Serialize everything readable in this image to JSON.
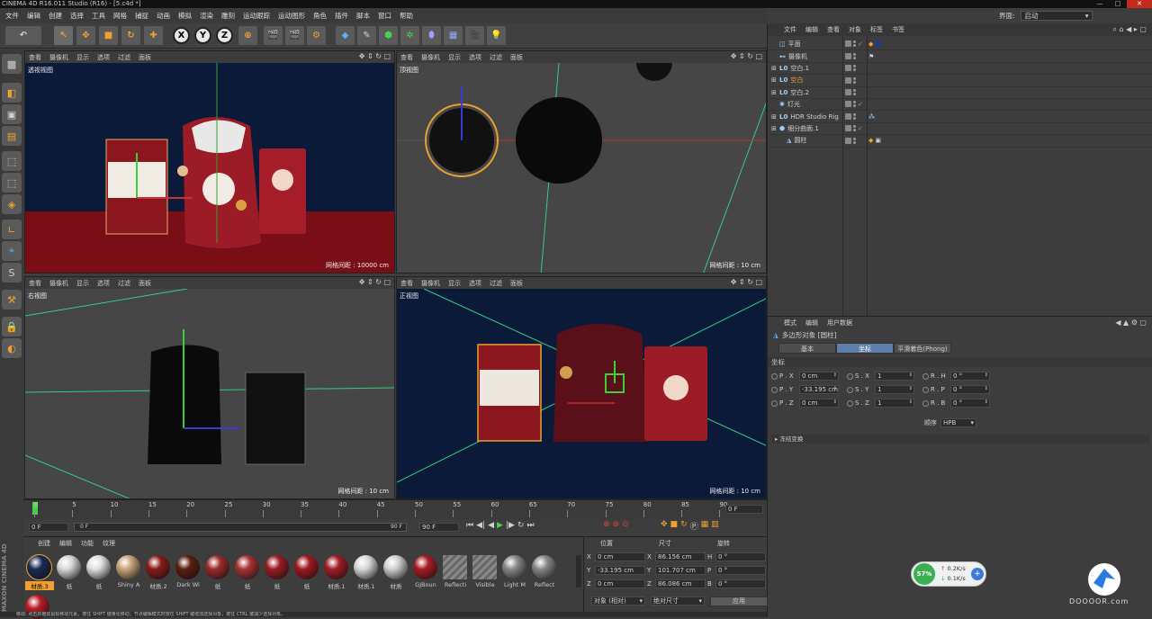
{
  "app": {
    "title": "CINEMA 4D R16.011 Studio (R16) - [5.c4d *]",
    "menu": [
      "文件",
      "编辑",
      "创建",
      "选择",
      "工具",
      "网格",
      "捕捉",
      "动画",
      "模拟",
      "渲染",
      "雕刻",
      "运动跟踪",
      "运动图形",
      "角色",
      "插件",
      "脚本",
      "窗口",
      "帮助"
    ],
    "layout_label": "界面:",
    "layout_value": "启动"
  },
  "viewport_menu": [
    "查看",
    "摄像机",
    "显示",
    "选项",
    "过滤",
    "面板"
  ],
  "viewports": [
    {
      "label": "透视视图",
      "grid": "网格间距 : 10000 cm"
    },
    {
      "label": "顶视图",
      "grid": "网格间距 : 10 cm"
    },
    {
      "label": "右视图",
      "grid": "网格间距 : 10 cm"
    },
    {
      "label": "正视图",
      "grid": "网格间距 : 10 cm"
    }
  ],
  "object_manager": {
    "menu": [
      "文件",
      "编辑",
      "查看",
      "对象",
      "标签",
      "书签"
    ],
    "objects": [
      {
        "name": "平面",
        "expand": false,
        "indent": 0
      },
      {
        "name": "摄像机",
        "expand": false,
        "indent": 0
      },
      {
        "name": "空白.1",
        "expand": true,
        "indent": 0
      },
      {
        "name": "空白",
        "expand": true,
        "indent": 0,
        "highlight": true
      },
      {
        "name": "空白.2",
        "expand": true,
        "indent": 0
      },
      {
        "name": "灯光",
        "expand": false,
        "indent": 0
      },
      {
        "name": "HDR Studio Rig",
        "expand": true,
        "indent": 0
      },
      {
        "name": "细分曲面.1",
        "expand": true,
        "indent": 0
      },
      {
        "name": "圆柱",
        "expand": false,
        "indent": 1
      }
    ]
  },
  "attributes": {
    "menu": [
      "模式",
      "编辑",
      "用户数据"
    ],
    "object_title": "多边形对象 [圆柱]",
    "tabs": [
      "基本",
      "坐标",
      "平滑着色(Phong)"
    ],
    "active_tab": "坐标",
    "section": "坐标",
    "pos": {
      "x": "0 cm",
      "y": "-33.195 cm",
      "z": "0 cm"
    },
    "scale": {
      "x": "1",
      "y": "1",
      "z": "1"
    },
    "rot": {
      "h": "0 °",
      "p": "0 °",
      "b": "0 °"
    },
    "order_label": "顺序",
    "order_value": "HPB",
    "freeze": "▸ 冻结变换",
    "axis_labels": {
      "px": "P . X",
      "py": "P . Y",
      "pz": "P . Z",
      "sx": "S . X",
      "sy": "S . Y",
      "sz": "S . Z",
      "rh": "R . H",
      "rp": "R . P",
      "rb": "R . B"
    }
  },
  "timeline": {
    "ticks": [
      "0",
      "5",
      "10",
      "15",
      "20",
      "25",
      "30",
      "35",
      "40",
      "45",
      "50",
      "55",
      "60",
      "65",
      "70",
      "75",
      "80",
      "85",
      "90"
    ],
    "current_frame": "0 F",
    "start_frame": "0 F",
    "range_start": "0 F",
    "range_end": "90 F",
    "end_frame": "90 F"
  },
  "materials": {
    "menu": [
      "创建",
      "编辑",
      "功能",
      "纹理"
    ],
    "items": [
      {
        "label": "材质.3",
        "color": "#1a2a55",
        "selected": true
      },
      {
        "label": "纸",
        "color": "#d8d8d8"
      },
      {
        "label": "纸",
        "color": "#e0e0e0"
      },
      {
        "label": "Shiny A",
        "color": "#c8a47a"
      },
      {
        "label": "材质.2",
        "color": "#8b1a1a"
      },
      {
        "label": "Dark Wi",
        "color": "#5a1e10"
      },
      {
        "label": "纸",
        "color": "#9a2a2a"
      },
      {
        "label": "纸",
        "color": "#a83232"
      },
      {
        "label": "纸",
        "color": "#9b1b22"
      },
      {
        "label": "纸",
        "color": "#a01820"
      },
      {
        "label": "材质.1",
        "color": "#a01c24"
      },
      {
        "label": "材质.1",
        "color": "#d8d8d8"
      },
      {
        "label": "材质",
        "color": "#cfcfcf"
      },
      {
        "label": "GJBoun",
        "color": "#a81c24"
      },
      {
        "label": "Reflecti",
        "color": "#777"
      },
      {
        "label": "Visible",
        "color": "#777"
      },
      {
        "label": "Light M",
        "color": "#888"
      },
      {
        "label": "Reflect",
        "color": "#888"
      }
    ],
    "extra_ball_color": "#b51c24"
  },
  "coords": {
    "headers": [
      "位置",
      "尺寸",
      "旋转"
    ],
    "rows": [
      {
        "a": "X",
        "pos": "0 cm",
        "b": "X",
        "size": "86.156 cm",
        "c": "H",
        "rot": "0 °"
      },
      {
        "a": "Y",
        "pos": "-33.195 cm",
        "b": "Y",
        "size": "101.707 cm",
        "c": "P",
        "rot": "0 °"
      },
      {
        "a": "Z",
        "pos": "0 cm",
        "b": "Z",
        "size": "86.086 cm",
        "c": "B",
        "rot": "0 °"
      }
    ],
    "mode1": "对象 (相对)",
    "mode2": "绝对尺寸",
    "apply": "应用"
  },
  "brand": "MAXON CINEMA 4D",
  "network": {
    "percent": "57%",
    "up": "0.2K/s",
    "down": "0.1K/s"
  },
  "watermark": "DOOOOR.com",
  "statusbar": "移动: 点击并拖动鼠标移动元素。按住 SHIFT 键量化移动；节点编辑模式时按住 SHIFT 键增加选择对象；按住 CTRL 键减少选择对象。",
  "colors": {
    "accent": "#5d7fa8",
    "viewport_dark": "#0c1a3a",
    "floor_red": "#7a0e16"
  }
}
